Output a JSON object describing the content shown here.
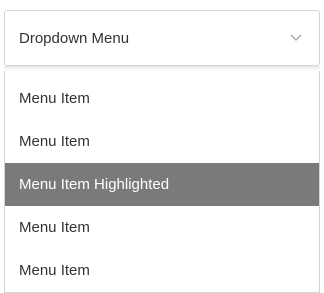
{
  "dropdown": {
    "selected_label": "Dropdown Menu",
    "chevron_icon": "chevron-down-icon",
    "items": [
      {
        "label": "Menu Item",
        "highlighted": false
      },
      {
        "label": "Menu Item",
        "highlighted": false
      },
      {
        "label": "Menu Item Highlighted",
        "highlighted": true
      },
      {
        "label": "Menu Item",
        "highlighted": false
      },
      {
        "label": "Menu Item",
        "highlighted": false
      }
    ]
  },
  "colors": {
    "highlight_background": "#7a7a7a",
    "highlight_text": "#ffffff",
    "text": "#333333",
    "border": "#d3d3d3"
  }
}
